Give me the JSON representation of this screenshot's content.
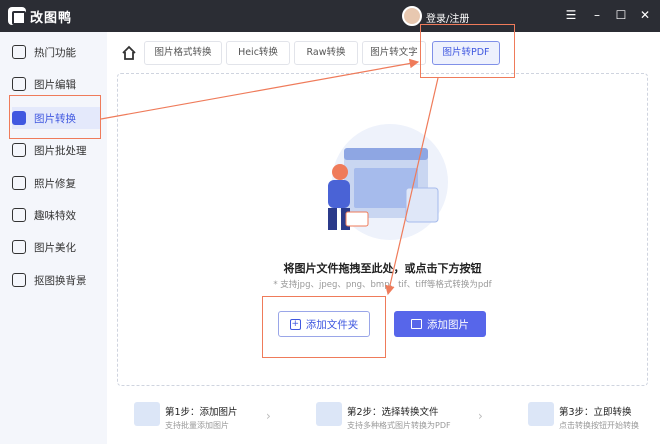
{
  "app": {
    "title": "改图鸭",
    "login_label": "登录/注册"
  },
  "window_controls": {
    "menu": "☰",
    "minimize": "–",
    "maximize": "☐",
    "close": "✕"
  },
  "sidebar": {
    "items": [
      {
        "label": "热门功能",
        "icon": "fire-icon"
      },
      {
        "label": "图片编辑",
        "icon": "image-edit-icon"
      },
      {
        "label": "图片转换",
        "icon": "convert-icon",
        "active": true
      },
      {
        "label": "图片批处理",
        "icon": "batch-icon"
      },
      {
        "label": "照片修复",
        "icon": "repair-icon"
      },
      {
        "label": "趣味特效",
        "icon": "sparkle-icon"
      },
      {
        "label": "图片美化",
        "icon": "beautify-icon"
      },
      {
        "label": "抠图换背景",
        "icon": "cutout-icon"
      }
    ]
  },
  "tabs": [
    {
      "label": "图片格式转换"
    },
    {
      "label": "Heic转换"
    },
    {
      "label": "Raw转换"
    },
    {
      "label": "图片转文字"
    },
    {
      "label": "图片转PDF",
      "active": true
    }
  ],
  "dropzone": {
    "title": "将图片文件拖拽至此处，或点击下方按钮",
    "subtitle": "* 支持jpg、jpeg、png、bmp、tif、tiff等格式转换为pdf"
  },
  "buttons": {
    "add_folder": "添加文件夹",
    "add_image": "添加图片"
  },
  "steps": [
    {
      "title": "第1步：添加图片",
      "sub": "支持批量添加图片"
    },
    {
      "title": "第2步：选择转换文件",
      "sub": "支持多种格式图片转换为PDF"
    },
    {
      "title": "第3步：立即转换",
      "sub": "点击转换按钮开始转换"
    }
  ],
  "colors": {
    "accent": "#5766ea",
    "highlight": "#ef7b5a",
    "titlebar": "#2b2d34"
  }
}
